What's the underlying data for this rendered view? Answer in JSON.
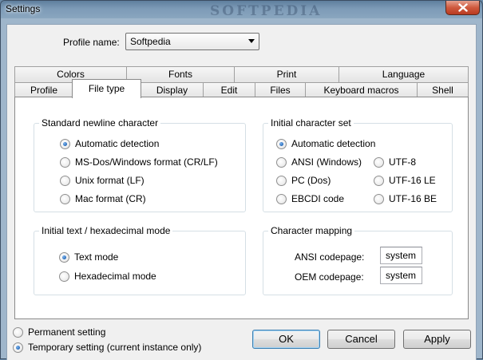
{
  "window": {
    "title": "Settings",
    "watermark": "SOFTPEDIA"
  },
  "profile": {
    "label": "Profile name:",
    "value": "Softpedia"
  },
  "tabs_row1": [
    "Colors",
    "Fonts",
    "Print",
    "Language"
  ],
  "tabs_row2": [
    "Profile",
    "File type",
    "Display",
    "Edit",
    "Files",
    "Keyboard macros",
    "Shell"
  ],
  "active_tab": "File type",
  "newline": {
    "title": "Standard newline character",
    "options": [
      "Automatic detection",
      "MS-Dos/Windows format (CR/LF)",
      "Unix format (LF)",
      "Mac format (CR)"
    ],
    "selected": "Automatic detection"
  },
  "charset": {
    "title": "Initial character set",
    "options": [
      "Automatic detection",
      "ANSI (Windows)",
      "UTF-8",
      "PC (Dos)",
      "UTF-16 LE",
      "EBCDI code",
      "UTF-16 BE"
    ],
    "selected": "Automatic detection"
  },
  "mode": {
    "title": "Initial text / hexadecimal mode",
    "options": [
      "Text mode",
      "Hexadecimal mode"
    ],
    "selected": "Text mode"
  },
  "mapping": {
    "title": "Character mapping",
    "ansi_label": "ANSI codepage:",
    "ansi_value": "system",
    "oem_label": "OEM codepage:",
    "oem_value": "system"
  },
  "scope": {
    "options": [
      "Permanent setting",
      "Temporary setting (current instance only)"
    ],
    "selected": "Temporary setting (current instance only)"
  },
  "buttons": {
    "ok": "OK",
    "cancel": "Cancel",
    "apply": "Apply"
  }
}
